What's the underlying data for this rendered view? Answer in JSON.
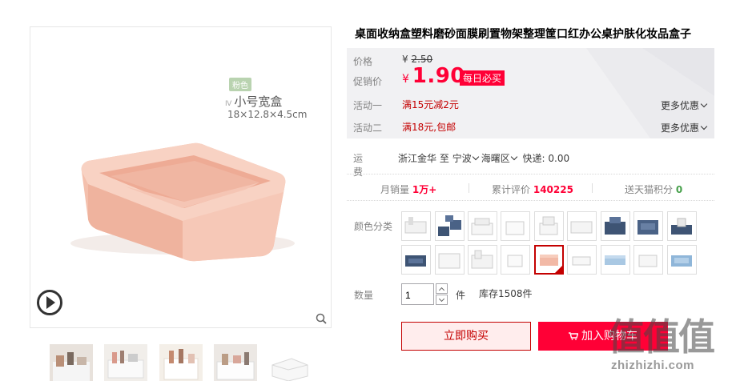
{
  "product": {
    "title": "桌面收纳盒塑料磨砂面膜刷置物架整理筐口红办公桌护肤化妆品盒子",
    "image_overlay": {
      "color_tag": "粉色",
      "size_title": "小号宽盒",
      "size_prefix": "Ⅳ",
      "dimensions": "18×12.8×4.5cm"
    }
  },
  "price": {
    "label": "价格",
    "currency": "¥",
    "original": "2.50",
    "promo_label": "促销价",
    "promo": "1.90",
    "promo_badge": "每日必买"
  },
  "activities": [
    {
      "label": "活动一",
      "text": "满15元减2元",
      "more": "更多优惠"
    },
    {
      "label": "活动二",
      "text": "满18元,包邮",
      "more": "更多优惠"
    }
  ],
  "shipping": {
    "label": "运费",
    "from": "浙江金华",
    "to_word": "至",
    "city": "宁波",
    "district": "海曙区",
    "express": "快递: 0.00"
  },
  "stats": {
    "monthly_label": "月销量",
    "monthly_value": "1万+",
    "reviews_label": "累计评价",
    "reviews_value": "140225",
    "points_label": "送天猫积分",
    "points_value": "0"
  },
  "sku": {
    "label": "颜色分类",
    "selected_index": 13
  },
  "quantity": {
    "label": "数量",
    "value": "1",
    "unit": "件",
    "stock": "库存1508件"
  },
  "actions": {
    "buy_now": "立即购买",
    "add_cart": "加入购物车"
  },
  "watermark": {
    "logo": "值值值",
    "url": "zhizhizhi.com"
  },
  "colors": {
    "accent": "#ff0036",
    "dark_red": "#c40000",
    "box_pink": "#f2b9a6"
  }
}
